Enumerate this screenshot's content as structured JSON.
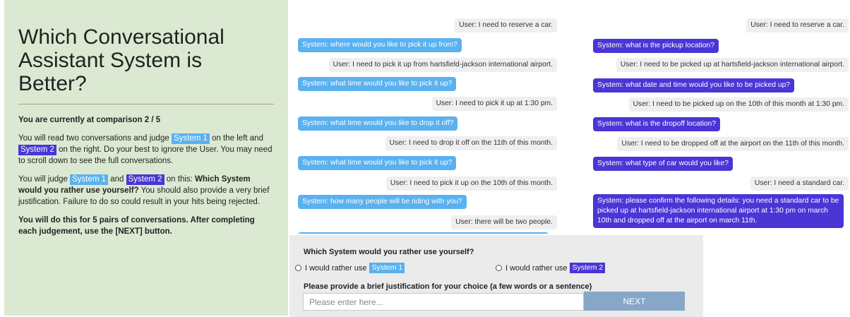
{
  "instructions": {
    "title": "Which Conversational Assistant System is Better?",
    "progress": "You are currently at comparison 2 / 5",
    "p1": {
      "a": "You will read two conversations and judge ",
      "tag1": "System 1",
      "b": " on the left and ",
      "tag2": "System 2",
      "c": " on the right. Do your best to ignore the ",
      "user": "User",
      "d": ". You may need to scroll down to see the full conversations."
    },
    "p2": {
      "a": "You will judge ",
      "tag1": "System 1",
      "b": " and ",
      "tag2": "System 2",
      "c": " on this: ",
      "question": "Which System would you rather use yourself?",
      "d": " You should also provide a very brief justification. Failure to do so could result in your hits being rejected."
    },
    "p3": "You will do this for 5 pairs of conversations.  After completing each judgement, use the [NEXT] button."
  },
  "conversation_1": {
    "messages": [
      {
        "role": "user",
        "text": "User: I need to reserve a car."
      },
      {
        "role": "system",
        "text": "System: where would you like to pick it up from?"
      },
      {
        "role": "user",
        "text": "User: I need to pick it up from hartsfield-jackson international airport."
      },
      {
        "role": "system",
        "text": "System: what time would you like to pick it up?"
      },
      {
        "role": "user",
        "text": "User: I need to pick it up at 1:30 pm."
      },
      {
        "role": "system",
        "text": "System: what time would you like to drop it off?"
      },
      {
        "role": "user",
        "text": "User: I need to drop it off on the 11th of this month."
      },
      {
        "role": "system",
        "text": "System: what time would you like to pick it up?"
      },
      {
        "role": "user",
        "text": "User: I need to pick it up on the 10th of this month."
      },
      {
        "role": "system",
        "text": "System: how many people will be riding with you?"
      },
      {
        "role": "user",
        "text": "User: there will be two people."
      }
    ]
  },
  "conversation_2": {
    "messages": [
      {
        "role": "user",
        "text": "User: I need to reserve a car."
      },
      {
        "role": "system",
        "text": "System: what is the pickup location?"
      },
      {
        "role": "user",
        "text": "User: I need to be picked up at hartsfield-jackson international airport."
      },
      {
        "role": "system",
        "text": "System: what date and time would you like to be picked up?"
      },
      {
        "role": "user",
        "text": "User: I need to be picked up on the 10th of this month at 1:30 pm."
      },
      {
        "role": "system",
        "text": "System: what is the dropoff location?"
      },
      {
        "role": "user",
        "text": "User: I need to be dropped off at the airport on the 11th of this month."
      },
      {
        "role": "system",
        "text": "System: what type of car would you like?"
      },
      {
        "role": "user",
        "text": "User: I need a standard car."
      },
      {
        "role": "system",
        "text": "System: please confirm the following details: you need a standard car to be picked up at hartsfield-jackson international airport at 1:30 pm on march 10th and dropped off at the airport on march 11th."
      }
    ]
  },
  "answer": {
    "question": "Which System would you rather use yourself?",
    "option1_prefix": "I would rather use",
    "option1_tag": "System 1",
    "option2_prefix": "I would rather use",
    "option2_tag": "System 2",
    "justification_label": "Please provide a brief justification for your choice (a few words or a sentence)",
    "justification_placeholder": "Please enter here...",
    "next_label": "NEXT"
  },
  "colors": {
    "instructions_bg": "#dce9d2",
    "system1": "#5ab1ef",
    "system2": "#4a35d6",
    "user_bubble": "#efefef",
    "next_button": "#86a7c7"
  }
}
